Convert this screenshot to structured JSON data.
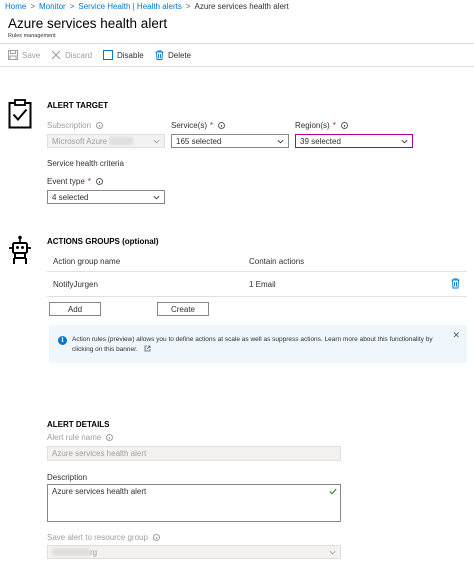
{
  "breadcrumb": {
    "items": [
      "Home",
      "Monitor",
      "Service Health | Health alerts"
    ],
    "current": "Azure services health alert"
  },
  "header": {
    "title": "Azure services health alert",
    "subtitle": "Rules management"
  },
  "toolbar": {
    "save": "Save",
    "discard": "Discard",
    "disable": "Disable",
    "delete": "Delete"
  },
  "alert_target": {
    "heading": "ALERT TARGET",
    "subscription_label": "Subscription",
    "subscription_value": "Microsoft Azure",
    "services_label": "Service(s)",
    "services_value": "165 selected",
    "regions_label": "Region(s)",
    "regions_value": "39 selected",
    "criteria_heading": "Service health criteria",
    "event_type_label": "Event type",
    "event_type_value": "4 selected",
    "required_mark": "*"
  },
  "actions_groups": {
    "heading": "ACTIONS GROUPS (optional)",
    "columns": [
      "Action group name",
      "Contain actions"
    ],
    "rows": [
      {
        "name": "NotifyJurgen",
        "actions": "1 Email"
      }
    ],
    "add_label": "Add",
    "create_label": "Create"
  },
  "banner": {
    "icon": "i",
    "text": "Action rules (preview) allows you to define actions at scale as well as suppress actions. Learn more about this functionality by clicking on this banner.",
    "close": "✕"
  },
  "alert_details": {
    "heading": "ALERT DETAILS",
    "rule_name_label": "Alert rule name",
    "rule_name_value": "Azure services health alert",
    "description_label": "Description",
    "description_value": "Azure services health alert",
    "resource_group_label": "Save alert to resource group",
    "resource_group_value": "rg"
  },
  "colors": {
    "link": "#0078d4",
    "required": "#a4262c",
    "focus_border": "#a300a3",
    "banner_bg": "#eff6fc",
    "check": "#107c10"
  }
}
